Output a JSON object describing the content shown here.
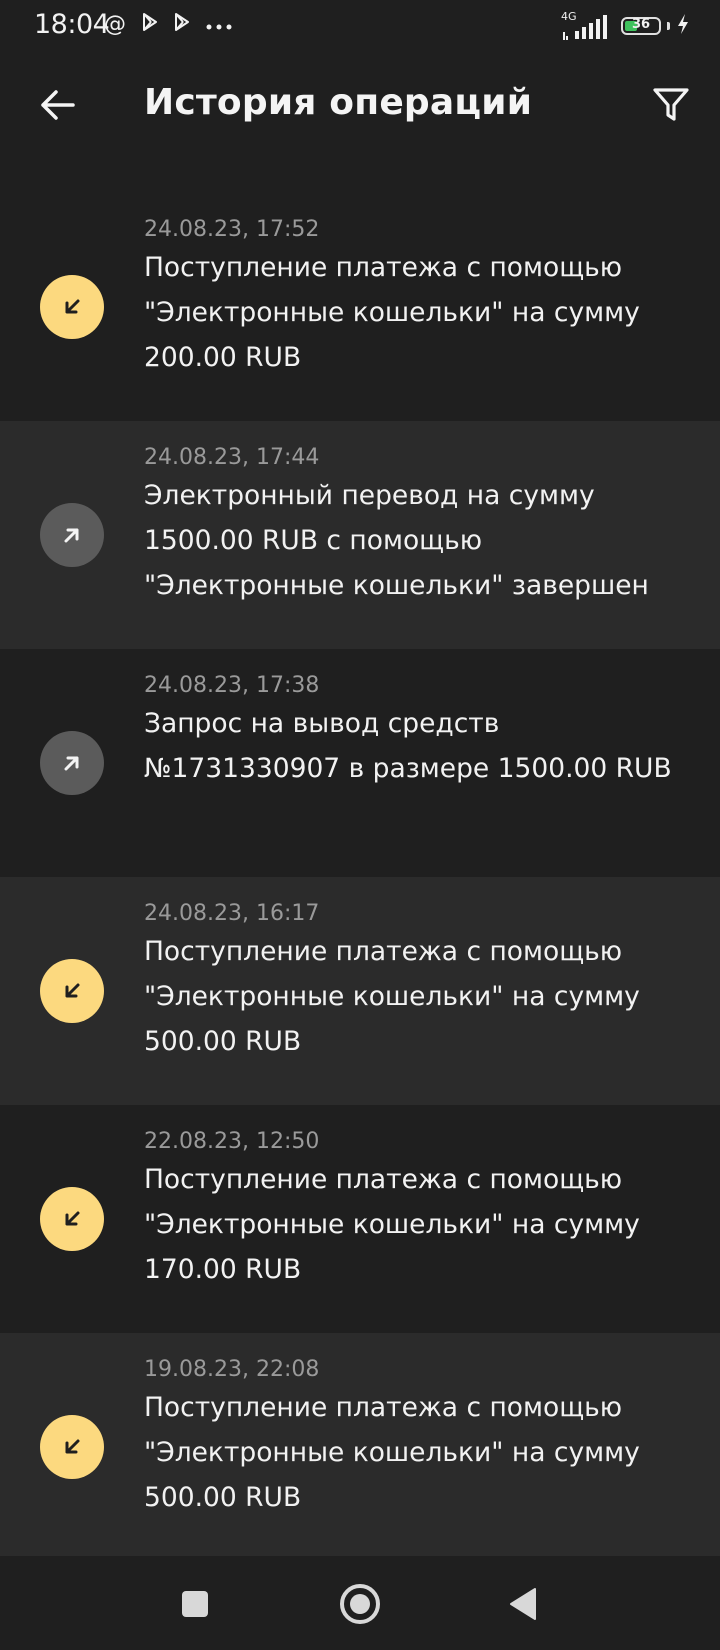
{
  "status_bar": {
    "time": "18:04",
    "network": "4G",
    "battery": "36",
    "battery_level": 0.36
  },
  "header": {
    "title": "История операций"
  },
  "operations": [
    {
      "date": "24.08.23, 17:52",
      "direction": "incoming",
      "description": "Поступление платежа с помощью \"Электронные кошельки\" на сумму 200.00 RUB"
    },
    {
      "date": "24.08.23, 17:44",
      "direction": "outgoing",
      "description": "Электронный перевод на сумму 1500.00 RUB с помощью \"Электронные кошельки\" завершен"
    },
    {
      "date": "24.08.23, 17:38",
      "direction": "outgoing",
      "description": "Запрос на вывод средств №1731330907 в размере 1500.00 RUB"
    },
    {
      "date": "24.08.23, 16:17",
      "direction": "incoming",
      "description": "Поступление платежа с помощью \"Электронные кошельки\" на сумму 500.00 RUB"
    },
    {
      "date": "22.08.23, 12:50",
      "direction": "incoming",
      "description": "Поступление платежа с помощью \"Электронные кошельки\" на сумму 170.00 RUB"
    },
    {
      "date": "19.08.23, 22:08",
      "direction": "incoming",
      "description": "Поступление платежа с помощью \"Электронные кошельки\" на сумму 500.00 RUB"
    }
  ],
  "colors": {
    "background": "#1f1f1f",
    "row_alt": "#2b2b2b",
    "incoming_icon_bg": "#fcd97f",
    "outgoing_icon_bg": "#5b5b5b",
    "date_text": "#9a9a9a",
    "battery_green": "#3fc25d"
  },
  "icons": {
    "back": "arrow-left-icon",
    "filter": "filter-icon",
    "incoming": "arrow-down-left-icon",
    "outgoing": "arrow-up-right-icon",
    "nav_recents": "square-icon",
    "nav_home": "circle-icon",
    "nav_back": "triangle-back-icon"
  }
}
